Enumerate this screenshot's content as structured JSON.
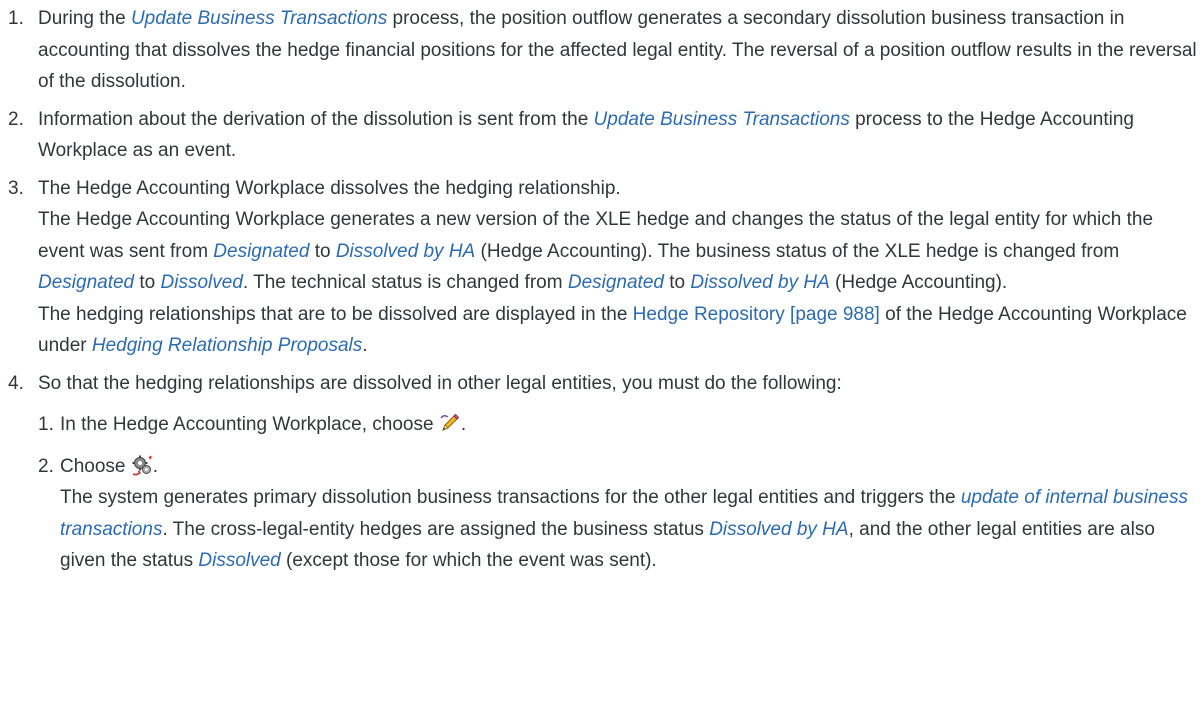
{
  "steps": [
    {
      "number": "1.",
      "paras": [
        [
          {
            "t": "During the "
          },
          {
            "t": "Update Business Transactions",
            "s": "em"
          },
          {
            "t": " process, the position outflow generates a secondary dissolution business transaction in accounting that dissolves the hedge financial positions for the affected legal entity. The reversal of a position outflow results in the reversal of the dissolution."
          }
        ]
      ]
    },
    {
      "number": "2.",
      "paras": [
        [
          {
            "t": "Information about the derivation of the dissolution is sent from the "
          },
          {
            "t": "Update Business Transactions",
            "s": "em"
          },
          {
            "t": " process to the Hedge Accounting Workplace as an event."
          }
        ]
      ]
    },
    {
      "number": "3.",
      "paras": [
        [
          {
            "t": "The Hedge Accounting Workplace dissolves the hedging relationship."
          }
        ],
        [
          {
            "t": "The Hedge Accounting Workplace generates a new version of the XLE hedge and changes the status of the legal entity for which the event was sent from "
          },
          {
            "t": "Designated",
            "s": "em"
          },
          {
            "t": " to "
          },
          {
            "t": "Dissolved by HA",
            "s": "em"
          },
          {
            "t": " (Hedge Accounting). The business status of the XLE hedge is changed from "
          },
          {
            "t": "Designated",
            "s": "em"
          },
          {
            "t": " to "
          },
          {
            "t": "Dissolved",
            "s": "em"
          },
          {
            "t": ". The technical status is changed from "
          },
          {
            "t": "Designated",
            "s": "em"
          },
          {
            "t": " to "
          },
          {
            "t": "Dissolved by HA",
            "s": "em"
          },
          {
            "t": " (Hedge Accounting)."
          }
        ],
        [
          {
            "t": "The hedging relationships that are to be dissolved are displayed in the "
          },
          {
            "t": "Hedge Repository [page 988]",
            "s": "link"
          },
          {
            "t": " of the Hedge Accounting Workplace under "
          },
          {
            "t": "Hedging Relationship Proposals",
            "s": "em"
          },
          {
            "t": "."
          }
        ]
      ]
    },
    {
      "number": "4.",
      "paras": [
        [
          {
            "t": "So that the hedging relationships are dissolved in other legal entities, you must do the following:"
          }
        ]
      ],
      "substeps": [
        {
          "number": "1.",
          "paras": [
            [
              {
                "t": "In the Hedge Accounting Workplace, choose "
              },
              {
                "icon": "edit-pencil-icon"
              },
              {
                "t": "."
              }
            ]
          ]
        },
        {
          "number": "2.",
          "paras": [
            [
              {
                "t": "Choose "
              },
              {
                "icon": "process-gears-icon"
              },
              {
                "t": "."
              }
            ],
            [
              {
                "t": "The system generates primary dissolution business transactions for the other legal entities and triggers the "
              },
              {
                "t": "update of internal business transactions",
                "s": "em"
              },
              {
                "t": ". The cross-legal-entity hedges are assigned the business status "
              },
              {
                "t": "Dissolved by HA",
                "s": "em"
              },
              {
                "t": ", and the other legal entities are also given the status "
              },
              {
                "t": "Dissolved",
                "s": "em"
              },
              {
                "t": " (except those for which the event was sent)."
              }
            ]
          ]
        }
      ]
    }
  ],
  "colors": {
    "text": "#32363a",
    "emphasis": "#2a6bb3",
    "link": "#2a6bb3"
  }
}
